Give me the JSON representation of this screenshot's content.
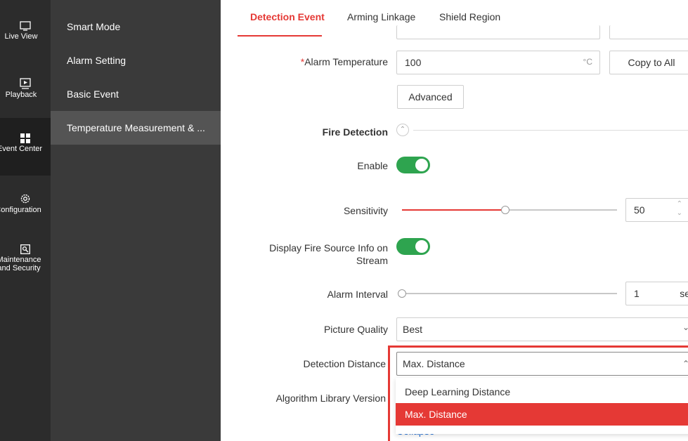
{
  "rail": {
    "items": [
      {
        "label": "Live View",
        "icon": "monitor-icon"
      },
      {
        "label": "Playback",
        "icon": "play-icon"
      },
      {
        "label": "Event Center",
        "icon": "grid-icon"
      },
      {
        "label": "Configuration",
        "icon": "gear-icon"
      },
      {
        "label": "Maintenance",
        "label2": "and Security",
        "icon": "wrench-icon"
      }
    ]
  },
  "subnav": {
    "items": [
      "Smart Mode",
      "Alarm Setting",
      "Basic Event",
      "Temperature Measurement & ..."
    ]
  },
  "tabs": [
    "Detection Event",
    "Arming Linkage",
    "Shield Region"
  ],
  "form": {
    "alarm_temperature": {
      "required_mark": "*",
      "label": "Alarm Temperature",
      "value": "100",
      "unit": "°C",
      "copy": "Copy to All"
    },
    "advanced": "Advanced",
    "fire_detection": "Fire Detection",
    "enable_label": "Enable",
    "sensitivity": {
      "label": "Sensitivity",
      "value": "50",
      "level": 0.48
    },
    "display_fire": {
      "line1": "Display Fire Source Info on",
      "line2": "Stream"
    },
    "alarm_interval": {
      "label": "Alarm Interval",
      "value": "1",
      "unit": "sec",
      "level": 0
    },
    "picture_quality": {
      "label": "Picture Quality",
      "value": "Best"
    },
    "detection_distance": {
      "label": "Detection Distance",
      "value": "Max. Distance"
    },
    "algorithm_label": "Algorithm Library Version",
    "options": [
      "Deep Learning Distance",
      "Max. Distance"
    ],
    "collapse": "Collapse"
  },
  "colors": {
    "accent": "#e53935",
    "toggle_on": "#2ea44f"
  }
}
